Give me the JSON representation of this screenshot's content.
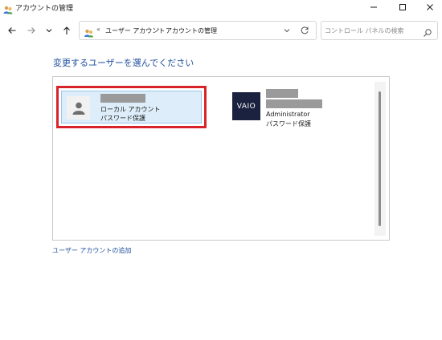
{
  "window": {
    "title": "アカウントの管理",
    "app_icon": "users-icon"
  },
  "address_bar": {
    "overflow_glyph": "«",
    "breadcrumbs": [
      "ユーザー アカウント",
      "アカウントの管理"
    ],
    "separator": "›"
  },
  "search": {
    "placeholder": "コントロール パネルの検索"
  },
  "heading": "変更するユーザーを選んでください",
  "accounts": [
    {
      "name": "",
      "type": "ローカル アカウント",
      "password": "パスワード保護",
      "selected": true,
      "avatar": "person-icon"
    },
    {
      "name": "",
      "type": "Administrator",
      "password": "パスワード保護",
      "selected": false,
      "avatar": "vaio-logo",
      "logo_text": "VAIO"
    }
  ],
  "add_user_link": "ユーザー アカウントの追加",
  "colors": {
    "link": "#1e4e9c",
    "selection_outline": "#d9232b",
    "selected_bg": "#ddeefa"
  }
}
